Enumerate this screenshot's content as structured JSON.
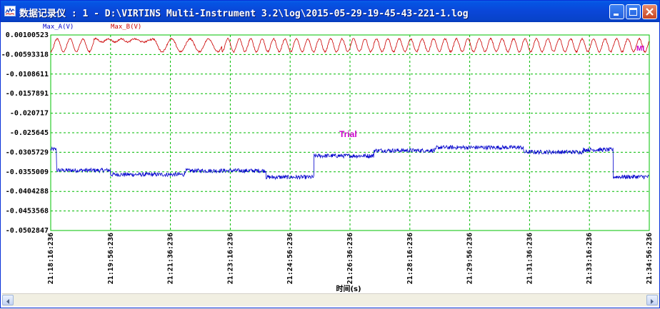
{
  "window": {
    "title": "数据记录仪 : 1 - D:\\VIRTINS Multi-Instrument 3.2\\log\\2015-05-29-19-45-43-221-1.log"
  },
  "title_buttons": {
    "minimize_icon": "minimize-icon",
    "maximize_icon": "maximize-icon",
    "close_icon": "close-icon"
  },
  "chart_data": {
    "type": "line",
    "title": "",
    "xlabel": "时间(s)",
    "ylabel": "",
    "annotation": "Trial",
    "corner_label": "MI",
    "grid": true,
    "legend_position": "top-left",
    "ylim": [
      -0.0502847,
      0.00100523
    ],
    "y_ticks": [
      "0.00100523",
      "-0.00593318",
      "-0.0108611",
      "-0.0157891",
      "-0.020717",
      "-0.025645",
      "-0.0305729",
      "-0.0355009",
      "-0.0404288",
      "-0.0453568",
      "-0.0502847"
    ],
    "x_ticks": [
      "21:18:16:236",
      "21:19:56:236",
      "21:21:36:236",
      "21:23:16:236",
      "21:24:56:236",
      "21:26:36:236",
      "21:28:16:236",
      "21:29:56:236",
      "21:31:36:236",
      "21:33:16:236",
      "21:34:56:236"
    ],
    "series": [
      {
        "name": "Max_A(V)",
        "color": "#0000cc",
        "segments": [
          {
            "from": "21:18:16",
            "to": "21:18:26",
            "level": -0.029
          },
          {
            "from": "21:18:26",
            "to": "21:19:56",
            "level": -0.0345
          },
          {
            "from": "21:19:56",
            "to": "21:22:00",
            "level": -0.0356
          },
          {
            "from": "21:22:00",
            "to": "21:24:16",
            "level": -0.0346
          },
          {
            "from": "21:24:16",
            "to": "21:25:36",
            "level": -0.0363
          },
          {
            "from": "21:25:36",
            "to": "21:27:16",
            "level": -0.0307
          },
          {
            "from": "21:27:16",
            "to": "21:29:00",
            "level": -0.0293
          },
          {
            "from": "21:29:00",
            "to": "21:31:26",
            "level": -0.0285
          },
          {
            "from": "21:31:26",
            "to": "21:33:06",
            "level": -0.0297
          },
          {
            "from": "21:33:06",
            "to": "21:33:56",
            "level": -0.0291
          },
          {
            "from": "21:33:56",
            "to": "21:34:56",
            "level": -0.0362
          }
        ]
      },
      {
        "name": "Max_B(V)",
        "color": "#cc0000",
        "range": [
          -0.004,
          0.0
        ],
        "pattern": "periodic dips"
      }
    ]
  }
}
